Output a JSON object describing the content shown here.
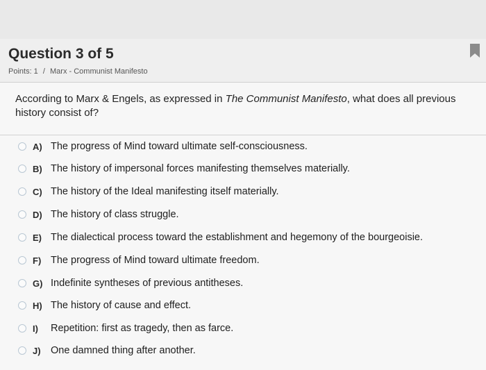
{
  "question": {
    "title": "Question 3 of 5",
    "points_label": "Points: 1",
    "separator": "/",
    "topic": "Marx - Communist Manifesto"
  },
  "prompt": {
    "before_italic": "According to Marx & Engels, as expressed in ",
    "italic": "The Communist Manifesto",
    "after_italic": ", what does all previous history consist of?"
  },
  "options": [
    {
      "letter": "A)",
      "text": "The progress of Mind toward ultimate self-consciousness."
    },
    {
      "letter": "B)",
      "text": "The history of impersonal forces manifesting themselves materially."
    },
    {
      "letter": "C)",
      "text": "The history of the Ideal manifesting itself materially."
    },
    {
      "letter": "D)",
      "text": "The history of class struggle."
    },
    {
      "letter": "E)",
      "text": "The dialectical process toward the establishment and hegemony of the bourgeoisie."
    },
    {
      "letter": "F)",
      "text": "The progress of Mind toward ultimate freedom."
    },
    {
      "letter": "G)",
      "text": "Indefinite syntheses of previous antitheses."
    },
    {
      "letter": "H)",
      "text": "The history of cause and effect."
    },
    {
      "letter": "I)",
      "text": "Repetition: first as tragedy, then as farce."
    },
    {
      "letter": "J)",
      "text": "One damned thing after another."
    }
  ],
  "icons": {
    "bookmark": "bookmark-icon",
    "radio": "radio-unchecked-icon"
  },
  "colors": {
    "bookmark": "#8a8a8a",
    "radio_border": "#b9c7d3"
  }
}
